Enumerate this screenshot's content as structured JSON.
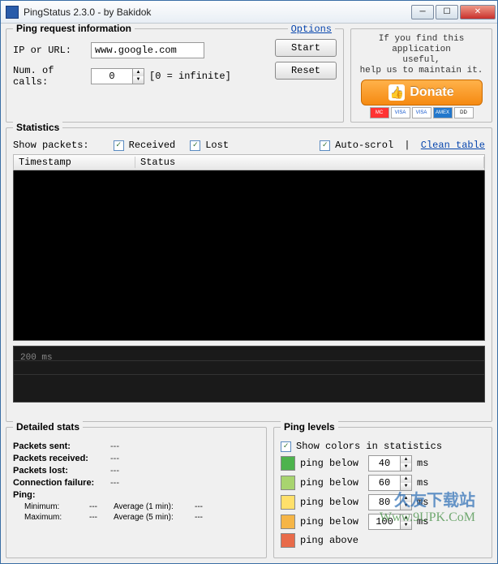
{
  "window": {
    "title": "PingStatus 2.3.0 - by Bakidok"
  },
  "pinginfo": {
    "legend": "Ping request information",
    "options_link": "Options",
    "ip_label": "IP or URL:",
    "ip_value": "www.google.com",
    "num_label": "Num. of calls:",
    "num_value": "0",
    "num_hint": "[0 = infinite]",
    "start_btn": "Start",
    "reset_btn": "Reset"
  },
  "donate": {
    "msg_l1": "If you find this application",
    "msg_l2": "useful,",
    "msg_l3": "help us to maintain it.",
    "btn": "Donate",
    "cards": [
      "MC",
      "VISA",
      "VISA",
      "AMEX",
      "DD"
    ]
  },
  "stats": {
    "legend": "Statistics",
    "show_packets": "Show packets:",
    "received": "Received",
    "lost": "Lost",
    "autoscroll": "Auto-scrol",
    "clean_table": "Clean table",
    "col_timestamp": "Timestamp",
    "col_status": "Status",
    "graph_label": "200 ms"
  },
  "detailed": {
    "legend": "Detailed stats",
    "packets_sent": "Packets sent:",
    "packets_received": "Packets received:",
    "packets_lost": "Packets lost:",
    "conn_failure": "Connection failure:",
    "ping": "Ping:",
    "minimum": "Minimum:",
    "maximum": "Maximum:",
    "avg1": "Average (1 min):",
    "avg5": "Average (5 min):",
    "dash": "---"
  },
  "levels": {
    "legend": "Ping levels",
    "show_colors": "Show colors in statistics",
    "below": "ping below",
    "above": "ping above",
    "ms": "ms",
    "thresholds": [
      "40",
      "60",
      "80",
      "100"
    ],
    "colors": [
      "#4db34d",
      "#a8d46f",
      "#ffe06b",
      "#f5b547",
      "#e86b4a"
    ]
  },
  "watermark": {
    "l1": "久友下载站",
    "l2": "Www.9UPK.CoM"
  }
}
